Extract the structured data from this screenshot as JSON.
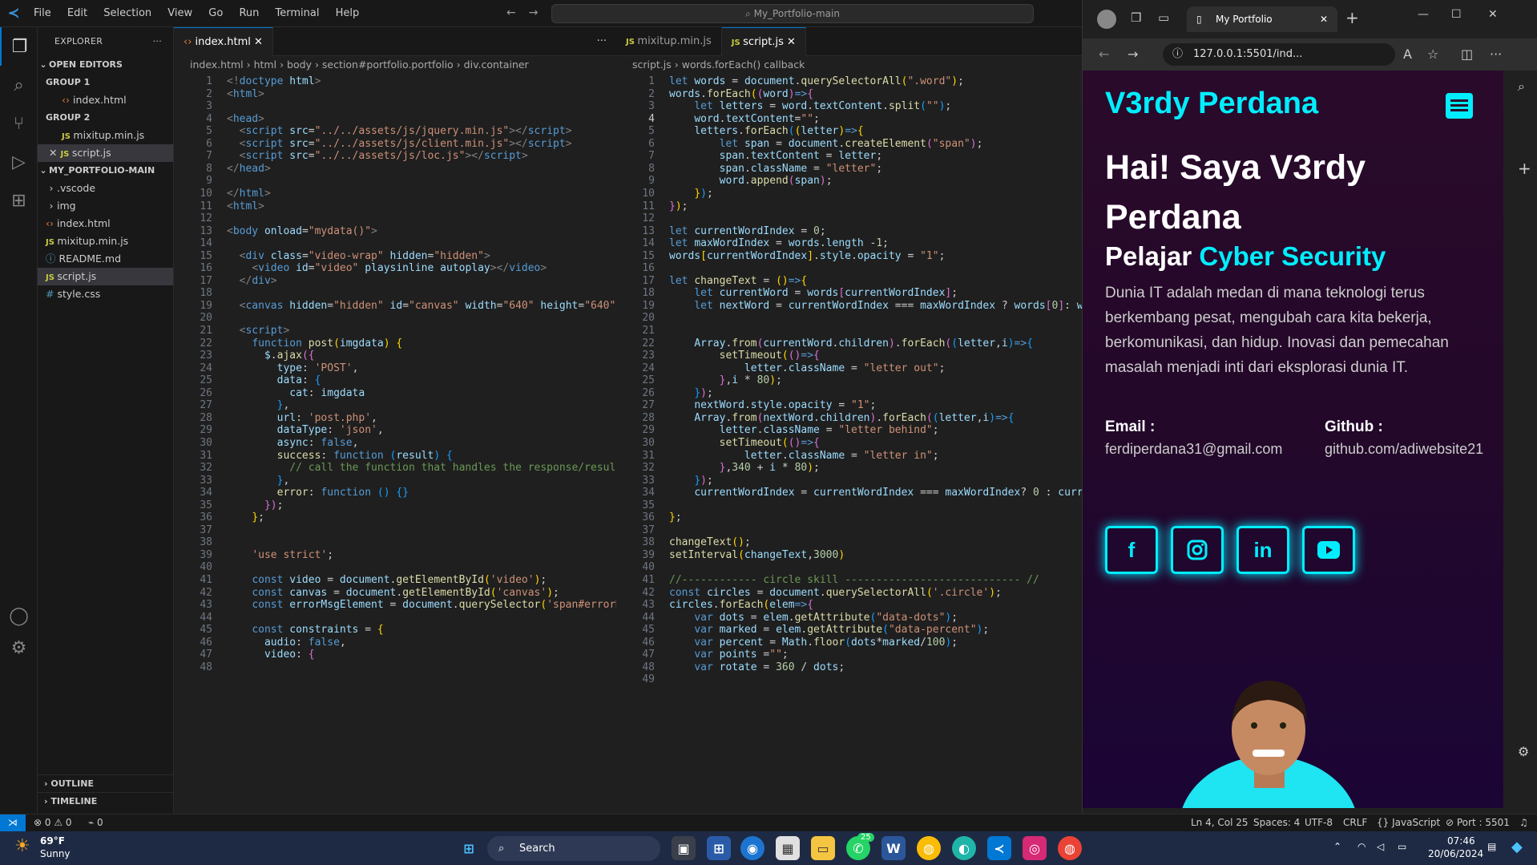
{
  "titlebar": {
    "menu": [
      "File",
      "Edit",
      "Selection",
      "View",
      "Go",
      "Run",
      "Terminal",
      "Help"
    ],
    "search_text": "My_Portfolio-main"
  },
  "explorer": {
    "header": "EXPLORER",
    "open_editors": "OPEN EDITORS",
    "group1": "GROUP 1",
    "group1_files": [
      "index.html"
    ],
    "group2": "GROUP 2",
    "group2_files": [
      "mixitup.min.js",
      "script.js"
    ],
    "project": "MY_PORTFOLIO-MAIN",
    "tree": [
      {
        "name": ".vscode",
        "type": "folder"
      },
      {
        "name": "img",
        "type": "folder"
      },
      {
        "name": "index.html",
        "type": "html"
      },
      {
        "name": "mixitup.min.js",
        "type": "js"
      },
      {
        "name": "README.md",
        "type": "md"
      },
      {
        "name": "script.js",
        "type": "js"
      },
      {
        "name": "style.css",
        "type": "css"
      }
    ],
    "outline": "OUTLINE",
    "timeline": "TIMELINE"
  },
  "editor_left": {
    "tab": "index.html",
    "breadcrumb": [
      "index.html",
      "html",
      "body",
      "section#portfolio.portfolio",
      "div.container"
    ],
    "line_start": 1,
    "line_end": 48
  },
  "editor_right": {
    "tabs": [
      "mixitup.min.js",
      "script.js"
    ],
    "breadcrumb": [
      "script.js",
      "words.forEach() callback"
    ],
    "line_start": 1,
    "line_end": 48,
    "current_line": 4
  },
  "browser": {
    "tab_title": "My Portfolio",
    "url": "127.0.0.1:5501/ind...",
    "brand": "V3rdy Perdana",
    "heading": "Hai! Saya V3rdy Perdana",
    "subheading_prefix": "Pelajar",
    "subheading_accent": "Cyber Security",
    "paragraph": "Dunia IT adalah medan di mana teknologi terus berkembang pesat, mengubah cara kita bekerja, berkomunikasi, dan hidup. Inovasi dan pemecahan masalah menjadi inti dari eksplorasi dunia IT.",
    "email_label": "Email :",
    "email_value": "ferdiperdana31@gmail.com",
    "github_label": "Github :",
    "github_value": "github.com/adiwebsite21",
    "social": [
      "f",
      "instagram-icon",
      "in",
      "youtube-icon"
    ]
  },
  "statusbar": {
    "errors": "0",
    "warnings": "0",
    "ports": "0",
    "position": "Ln 4, Col 25",
    "spaces": "Spaces: 4",
    "encoding": "UTF-8",
    "eol": "CRLF",
    "language": "JavaScript",
    "port": "Port : 5501"
  },
  "taskbar": {
    "weather_temp": "69°F",
    "weather_desc": "Sunny",
    "search": "Search",
    "time": "07:46",
    "date": "20/06/2024",
    "badge": "25"
  },
  "colors": {
    "accent": "#00eeff",
    "vscode_blue": "#0078d4",
    "page_bg": "#2a0a2a"
  }
}
